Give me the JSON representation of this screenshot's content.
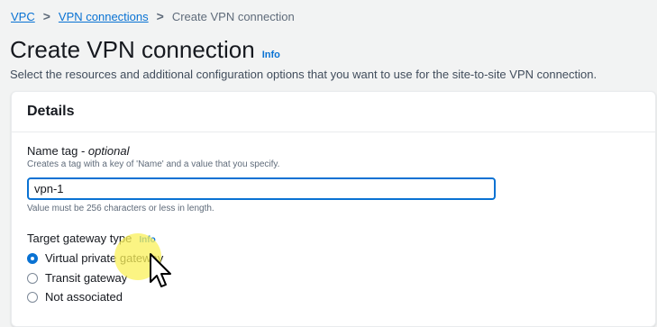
{
  "breadcrumb": {
    "items": [
      "VPC",
      "VPN connections"
    ],
    "separator": ">",
    "current": "Create VPN connection"
  },
  "header": {
    "title": "Create VPN connection",
    "info": "Info",
    "description": "Select the resources and additional configuration options that you want to use for the site-to-site VPN connection."
  },
  "details": {
    "title": "Details",
    "name_tag": {
      "label": "Name tag - ",
      "label_optional": "optional",
      "hint": "Creates a tag with a key of 'Name' and a value that you specify.",
      "value": "vpn-1",
      "constraint": "Value must be 256 characters or less in length."
    },
    "target_gateway": {
      "label": "Target gateway type",
      "info": "Info",
      "options": [
        {
          "label": "Virtual private gateway",
          "selected": true
        },
        {
          "label": "Transit gateway",
          "selected": false
        },
        {
          "label": "Not associated",
          "selected": false
        }
      ]
    }
  },
  "colors": {
    "link": "#0972d3",
    "highlight": "#faf05a",
    "background": "#f2f3f3"
  },
  "icons": {
    "cursor": "mouse-pointer-icon",
    "separator": "chevron-right-icon"
  }
}
